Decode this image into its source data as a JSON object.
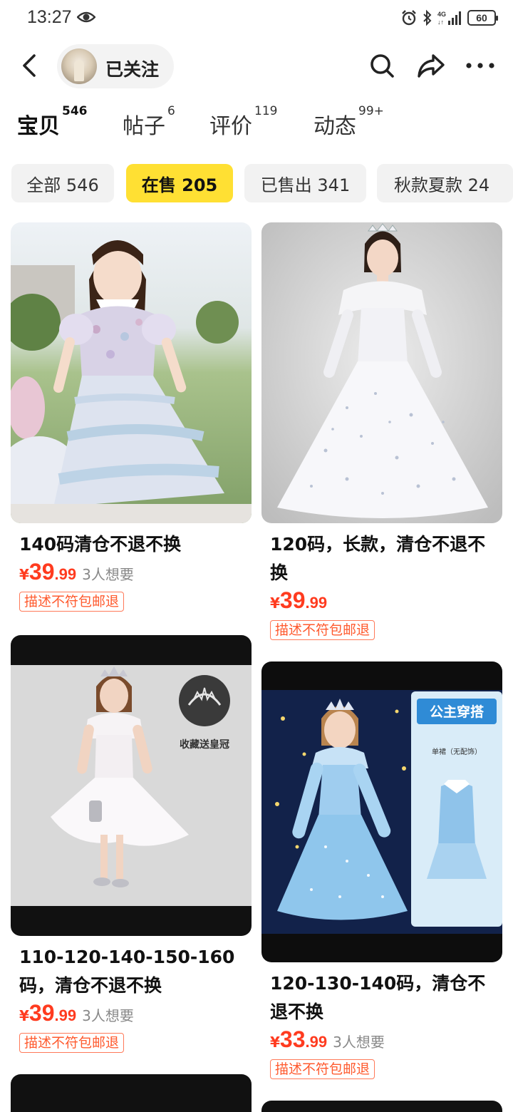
{
  "status_bar": {
    "time": "13:27",
    "battery": "60"
  },
  "header": {
    "follow_label": "已关注"
  },
  "tabs": [
    {
      "label": "宝贝",
      "count": "546"
    },
    {
      "label": "帖子",
      "count": "6"
    },
    {
      "label": "评价",
      "count": "119"
    },
    {
      "label": "动态",
      "count": "99+"
    }
  ],
  "filters": [
    {
      "label": "全部 546"
    },
    {
      "label": "在售 205"
    },
    {
      "label": "已售出 341"
    },
    {
      "label": "秋款夏款 24"
    }
  ],
  "products": [
    {
      "title": "140码清仓不退不换",
      "price_int": "39",
      "price_dec": ".99",
      "want": "3人想要",
      "tag": "描述不符包邮退"
    },
    {
      "title": "120码，长款，清仓不退不换",
      "price_int": "39",
      "price_dec": ".99",
      "want": "",
      "tag": "描述不符包邮退"
    },
    {
      "title": "110-120-140-150-160码，清仓不退不换",
      "price_int": "39",
      "price_dec": ".99",
      "want": "3人想要",
      "tag": "描述不符包邮退"
    },
    {
      "title": "120-130-140码，清仓不退不换",
      "price_int": "33",
      "price_dec": ".99",
      "want": "3人想要",
      "tag": "描述不符包邮退"
    }
  ],
  "image_text": {
    "crown_caption": "收藏送皇冠",
    "princess_title": "公主穿搭",
    "dress_label": "单裙（无配饰）"
  },
  "currency": "¥",
  "colors": {
    "accent_yellow": "#ffe033",
    "price_red": "#ff3b1f"
  }
}
